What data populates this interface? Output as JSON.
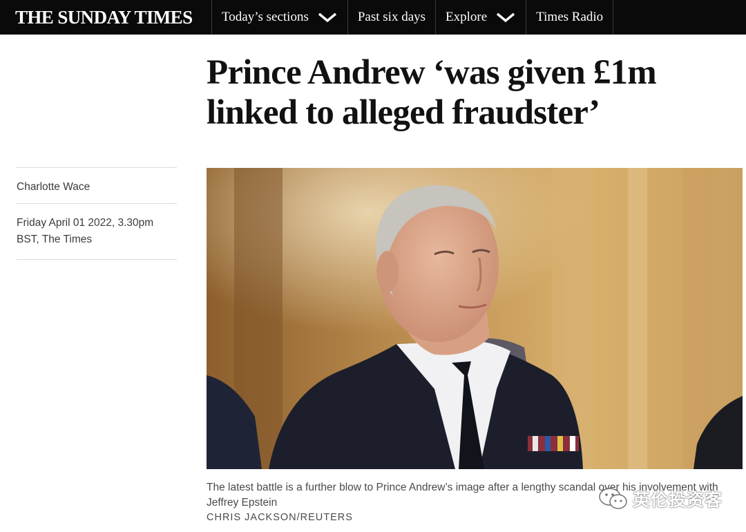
{
  "masthead": {
    "brand": "THE SUNDAY TIMES"
  },
  "nav": {
    "items": [
      {
        "label": "Today’s sections",
        "has_dropdown": true
      },
      {
        "label": "Past six days",
        "has_dropdown": false
      },
      {
        "label": "Explore",
        "has_dropdown": true
      },
      {
        "label": "Times Radio",
        "has_dropdown": false
      }
    ]
  },
  "article": {
    "headline": "Prince Andrew ‘was given £1m linked to alleged fraudster’",
    "author": "Charlotte Wace",
    "dateline": "Friday April 01 2022, 3.30pm BST, The Times",
    "image": {
      "caption": "The latest battle is a further blow to Prince Andrew’s image after a lengthy scandal over his involvement with Jeffrey Epstein",
      "credit": "CHRIS JACKSON/REUTERS"
    }
  },
  "watermark": {
    "text": "英伦投资客",
    "icon": "wechat-icon"
  },
  "colors": {
    "nav_bg": "#0a0a0a",
    "nav_text": "#ffffff",
    "headline": "#111111",
    "meta_text": "#3b3b3b"
  }
}
